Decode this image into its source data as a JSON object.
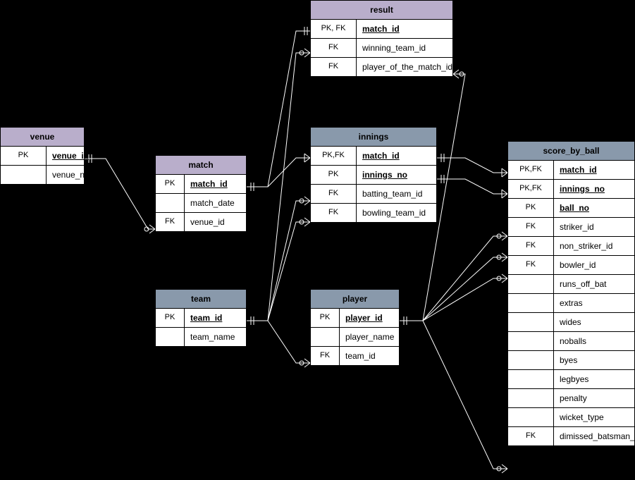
{
  "entities": {
    "venue": {
      "title": "venue",
      "rows": [
        {
          "key": "PK",
          "field": "venue_id",
          "pk": true
        },
        {
          "key": "",
          "field": "venue_name",
          "pk": false
        }
      ]
    },
    "match": {
      "title": "match",
      "rows": [
        {
          "key": "PK",
          "field": "match_id",
          "pk": true
        },
        {
          "key": "",
          "field": "match_date",
          "pk": false
        },
        {
          "key": "FK",
          "field": "venue_id",
          "pk": false
        }
      ]
    },
    "team": {
      "title": "team",
      "rows": [
        {
          "key": "PK",
          "field": "team_id",
          "pk": true
        },
        {
          "key": "",
          "field": "team_name",
          "pk": false
        }
      ]
    },
    "result": {
      "title": "result",
      "rows": [
        {
          "key": "PK, FK",
          "field": "match_id",
          "pk": true
        },
        {
          "key": "FK",
          "field": "winning_team_id",
          "pk": false
        },
        {
          "key": "FK",
          "field": "player_of_the_match_id",
          "pk": false
        }
      ]
    },
    "innings": {
      "title": "innings",
      "rows": [
        {
          "key": "PK,FK",
          "field": "match_id",
          "pk": true
        },
        {
          "key": "PK",
          "field": "innings_no",
          "pk": true
        },
        {
          "key": "FK",
          "field": "batting_team_id",
          "pk": false
        },
        {
          "key": "FK",
          "field": "bowling_team_id",
          "pk": false
        }
      ]
    },
    "player": {
      "title": "player",
      "rows": [
        {
          "key": "PK",
          "field": "player_id",
          "pk": true
        },
        {
          "key": "",
          "field": "player_name",
          "pk": false
        },
        {
          "key": "FK",
          "field": "team_id",
          "pk": false
        }
      ]
    },
    "score_by_ball": {
      "title": "score_by_ball",
      "rows": [
        {
          "key": "PK,FK",
          "field": "match_id",
          "pk": true
        },
        {
          "key": "PK,FK",
          "field": "innings_no",
          "pk": true
        },
        {
          "key": "PK",
          "field": "ball_no",
          "pk": true
        },
        {
          "key": "FK",
          "field": "striker_id",
          "pk": false
        },
        {
          "key": "FK",
          "field": "non_striker_id",
          "pk": false
        },
        {
          "key": "FK",
          "field": "bowler_id",
          "pk": false
        },
        {
          "key": "",
          "field": "runs_off_bat",
          "pk": false
        },
        {
          "key": "",
          "field": "extras",
          "pk": false
        },
        {
          "key": "",
          "field": "wides",
          "pk": false
        },
        {
          "key": "",
          "field": "noballs",
          "pk": false
        },
        {
          "key": "",
          "field": "byes",
          "pk": false
        },
        {
          "key": "",
          "field": "legbyes",
          "pk": false
        },
        {
          "key": "",
          "field": "penalty",
          "pk": false
        },
        {
          "key": "",
          "field": "wicket_type",
          "pk": false
        },
        {
          "key": "FK",
          "field": "dimissed_batsman_id",
          "pk": false
        }
      ]
    }
  },
  "relationships": [
    {
      "from": "venue.venue_id",
      "to": "match.venue_id"
    },
    {
      "from": "match.match_id",
      "to": "result.match_id"
    },
    {
      "from": "match.match_id",
      "to": "innings.match_id"
    },
    {
      "from": "team.team_id",
      "to": "result.winning_team_id"
    },
    {
      "from": "team.team_id",
      "to": "innings.batting_team_id"
    },
    {
      "from": "team.team_id",
      "to": "innings.bowling_team_id"
    },
    {
      "from": "team.team_id",
      "to": "player.team_id"
    },
    {
      "from": "innings.match_id+innings_no",
      "to": "score_by_ball.match_id+innings_no"
    },
    {
      "from": "player.player_id",
      "to": "result.player_of_the_match_id"
    },
    {
      "from": "player.player_id",
      "to": "score_by_ball.striker_id"
    },
    {
      "from": "player.player_id",
      "to": "score_by_ball.non_striker_id"
    },
    {
      "from": "player.player_id",
      "to": "score_by_ball.bowler_id"
    },
    {
      "from": "player.player_id",
      "to": "score_by_ball.dimissed_batsman_id"
    }
  ]
}
